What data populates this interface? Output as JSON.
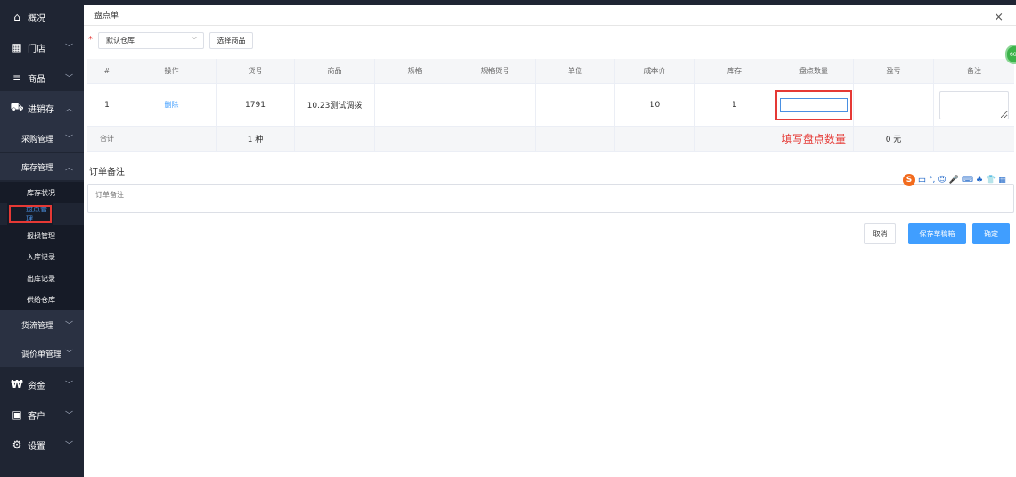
{
  "sidebar": {
    "overview": "概况",
    "store": "门店",
    "goods": "商品",
    "inventory": "进销存",
    "purchase": "采购管理",
    "stock_mgmt": "库存管理",
    "leaf_items": [
      "库存状况",
      "盘点管理",
      "报损管理",
      "入库记录",
      "出库记录",
      "供给仓库"
    ],
    "logistics": "货流管理",
    "price_adjust": "调价单管理",
    "funds": "资金",
    "customers": "客户",
    "settings": "设置"
  },
  "dialog": {
    "title": "盘点单",
    "close": "×",
    "warehouse": "默认仓库",
    "pick_goods": "选择商品",
    "columns": [
      "#",
      "操作",
      "货号",
      "商品",
      "规格",
      "规格货号",
      "单位",
      "成本价",
      "库存",
      "盘点数量",
      "盈亏",
      "备注"
    ],
    "row": {
      "index": "1",
      "action": "删除",
      "sku": "1791",
      "product": "10.23测试调拨",
      "spec": "",
      "spec_sku": "",
      "unit": "",
      "cost": "10",
      "stock": "1",
      "count_value": "",
      "profit_loss": "",
      "note_value": ""
    },
    "total": {
      "label": "合计",
      "kinds": "1 种",
      "hint": "填写盘点数量",
      "amount": "0 元"
    },
    "order_note_label": "订单备注",
    "order_note_placeholder": "订单备注",
    "cancel": "取消",
    "save_draft": "保存草稿箱",
    "confirm": "确定"
  },
  "ime": {
    "logo": "S",
    "lang": "中",
    "icons": [
      "°,",
      "☺",
      "🎤",
      "⌨",
      "♣",
      "👕",
      "▦"
    ]
  },
  "float_badge": "60"
}
